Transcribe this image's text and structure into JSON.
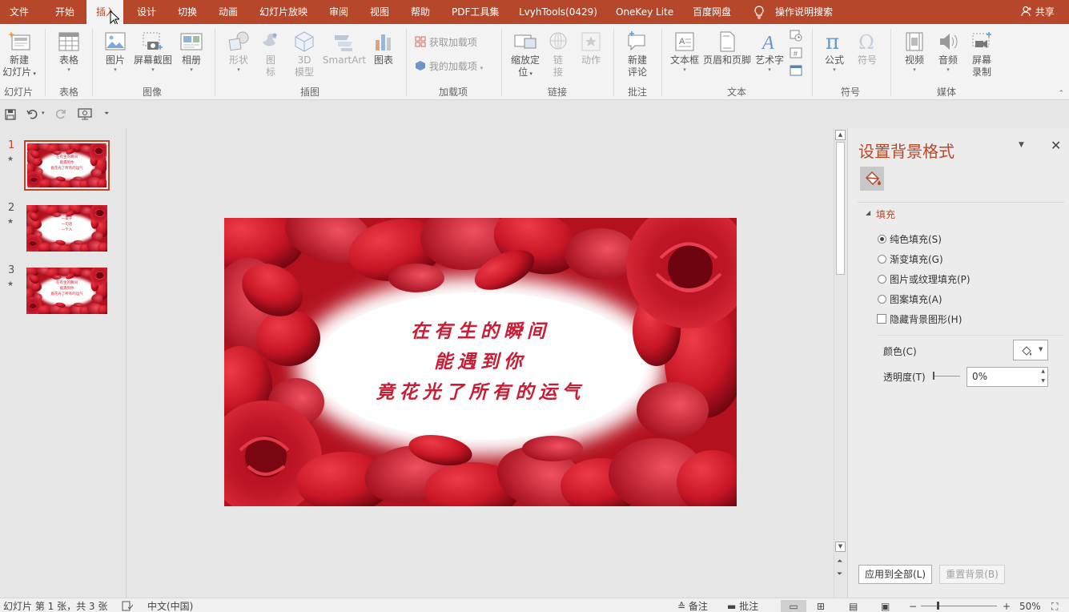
{
  "menu": {
    "tabs": [
      "文件",
      "开始",
      "插入",
      "设计",
      "切换",
      "动画",
      "幻灯片放映",
      "审阅",
      "视图",
      "帮助",
      "PDF工具集",
      "LvyhTools(0429)",
      "OneKey Lite",
      "百度网盘"
    ],
    "active_tab": "插入",
    "tell_me": "操作说明搜索",
    "share": "共享"
  },
  "ribbon": {
    "new_slide": [
      "新建",
      "幻灯片"
    ],
    "table": "表格",
    "picture": "图片",
    "screenshot": "屏幕截图",
    "album": "相册",
    "shapes": "形状",
    "icons": [
      "图",
      "标"
    ],
    "model3d": [
      "3D",
      "模型"
    ],
    "smartart": "SmartArt",
    "chart": "图表",
    "get_addins": "获取加载项",
    "my_addins": "我的加载项",
    "zoom": [
      "缩放定",
      "位"
    ],
    "link": [
      "链",
      "接"
    ],
    "action": "动作",
    "new_comment": [
      "新建",
      "评论"
    ],
    "textbox": "文本框",
    "header_footer": "页眉和页脚",
    "wordart": "艺术字",
    "equation": "公式",
    "symbol": "符号",
    "video": "视频",
    "audio": "音频",
    "screen_record": [
      "屏幕",
      "录制"
    ],
    "groups": [
      "幻灯片",
      "表格",
      "图像",
      "插图",
      "加载项",
      "链接",
      "批注",
      "文本",
      "符号",
      "媒体"
    ]
  },
  "thumbnails": [
    {
      "num": "1",
      "lines": [
        "在有生的瞬间",
        "能遇到你",
        "竟花光了所有的运气"
      ],
      "selected": true
    },
    {
      "num": "2",
      "lines": [
        "一辈子",
        "一句话",
        "一个人"
      ],
      "selected": false
    },
    {
      "num": "3",
      "lines": [
        "在有生的瞬间",
        "能遇到你",
        "竟花光了所有的运气"
      ],
      "selected": false
    }
  ],
  "slide": {
    "lines": [
      "在有生的瞬间",
      "能遇到你",
      "竟花光了所有的运气"
    ]
  },
  "panel": {
    "title": "设置背景格式",
    "section": "填充",
    "options": [
      "纯色填充(S)",
      "渐变填充(G)",
      "图片或纹理填充(P)",
      "图案填充(A)"
    ],
    "selected_option": 0,
    "hide_bg": "隐藏背景图形(H)",
    "color_label": "颜色(C)",
    "transparency_label": "透明度(T)",
    "transparency_value": "0%",
    "apply_all": "应用到全部(L)",
    "reset": "重置背景(B)"
  },
  "status": {
    "slide_info": "幻灯片 第 1 张，共 3 张",
    "language": "中文(中国)",
    "notes": "备注",
    "comments": "批注",
    "zoom": "50%"
  },
  "colors": {
    "accent": "#b7472a",
    "rose": "#c71d35"
  }
}
